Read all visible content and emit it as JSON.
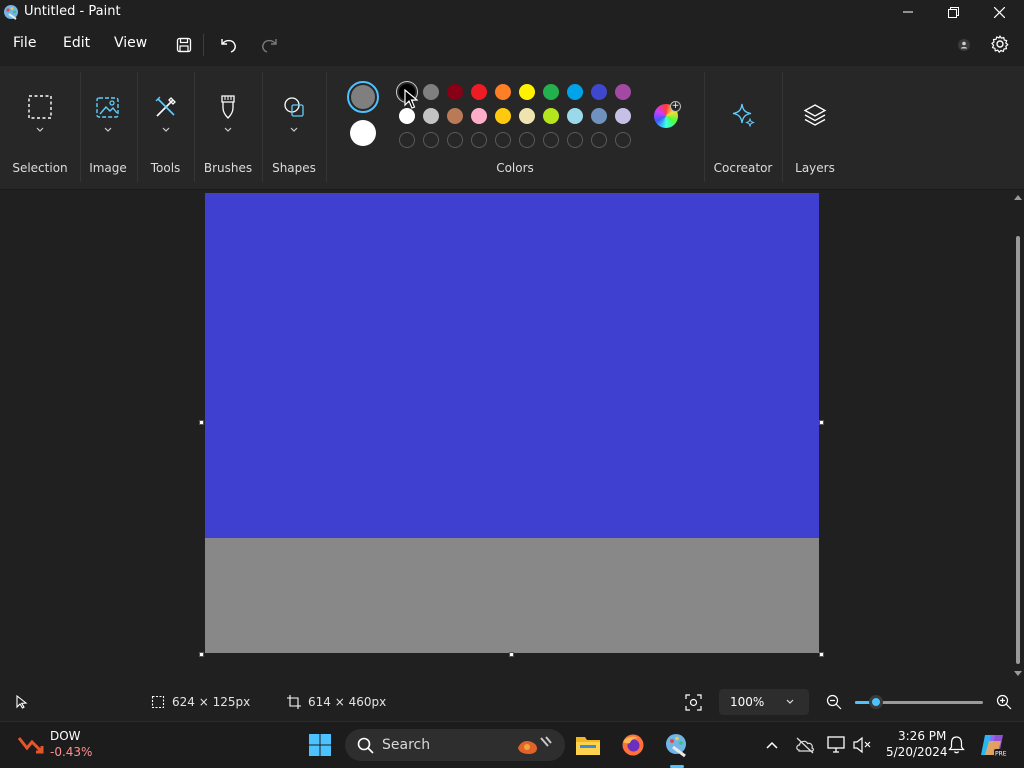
{
  "window": {
    "title": "Untitled - Paint"
  },
  "menu": {
    "file": "File",
    "edit": "Edit",
    "view": "View"
  },
  "ribbon": {
    "groups": {
      "selection": "Selection",
      "image": "Image",
      "tools": "Tools",
      "brushes": "Brushes",
      "shapes": "Shapes",
      "colors": "Colors",
      "cocreator": "Cocreator",
      "layers": "Layers"
    }
  },
  "colors": {
    "primary": "#7f7f7f",
    "secondary": "#ffffff",
    "row1": [
      "#000000",
      "#7f7f7f",
      "#880015",
      "#ed1c24",
      "#ff7f27",
      "#fff200",
      "#22b14c",
      "#00a2e8",
      "#3f48cc",
      "#a349a4"
    ],
    "row2": [
      "#ffffff",
      "#c3c3c3",
      "#b97a57",
      "#ffaec9",
      "#ffc90e",
      "#efe4b0",
      "#b5e61d",
      "#99d9ea",
      "#7092be",
      "#c8bfe7"
    ],
    "selected_index": 0
  },
  "canvas": {
    "fill_top": "#4040d0",
    "fill_bottom": "#888888"
  },
  "status": {
    "selection_size": "624 × 125px",
    "canvas_size": "614 × 460px",
    "zoom": "100%"
  },
  "taskbar": {
    "stock_name": "DOW",
    "stock_change": "-0.43%",
    "search_placeholder": "Search",
    "time": "3:26 PM",
    "date": "5/20/2024"
  }
}
